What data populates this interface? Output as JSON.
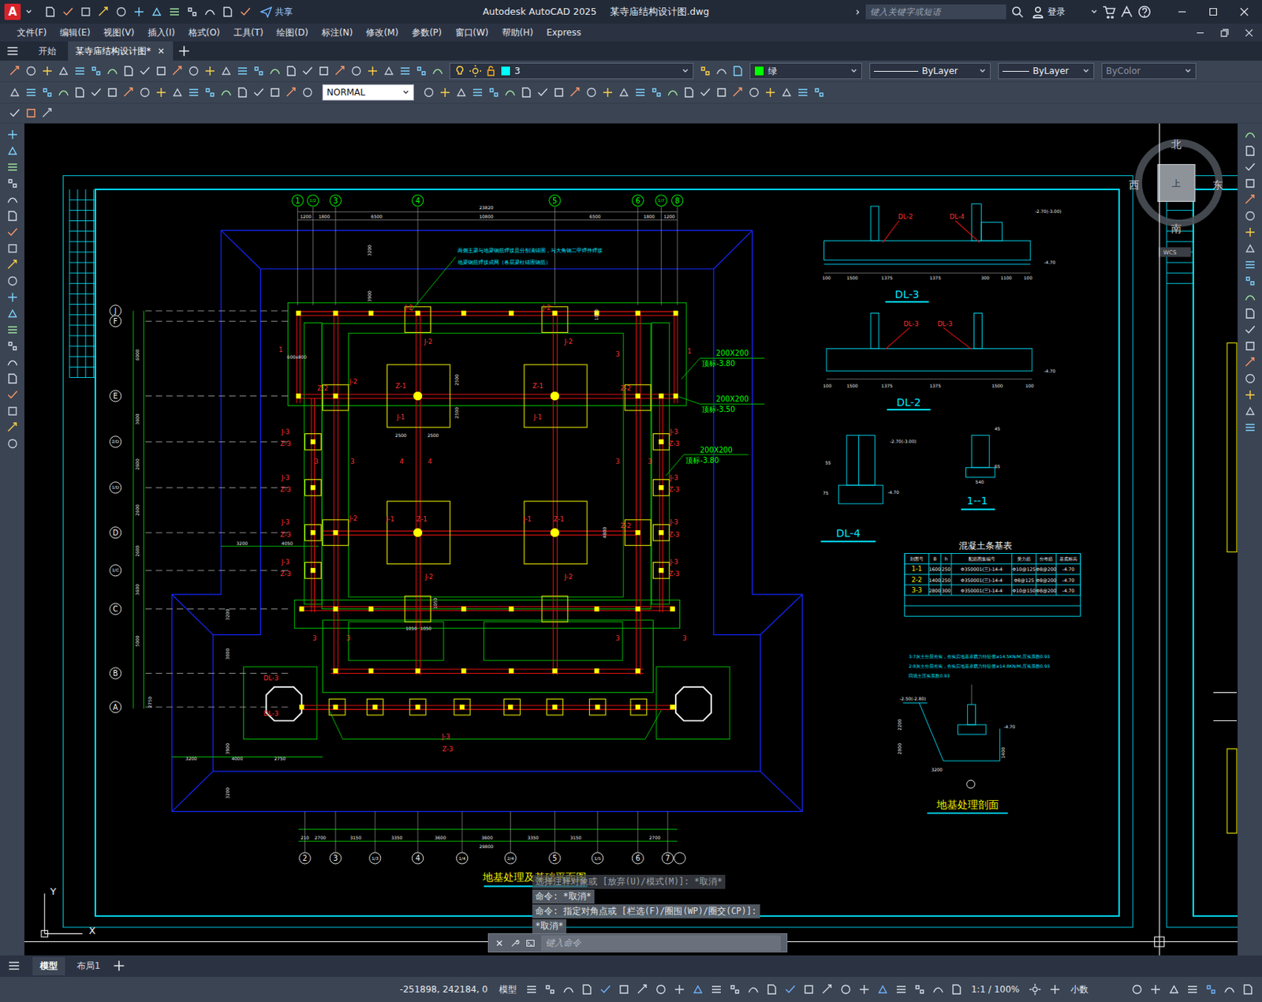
{
  "window": {
    "app_letter": "A",
    "title": "Autodesk AutoCAD 2025",
    "file": "某寺庙结构设计图.dwg",
    "share": "共享",
    "search_placeholder": "键入关键字或短语",
    "login": "登录"
  },
  "menu": [
    "文件(F)",
    "编辑(E)",
    "视图(V)",
    "插入(I)",
    "格式(O)",
    "工具(T)",
    "绘图(D)",
    "标注(N)",
    "修改(M)",
    "参数(P)",
    "窗口(W)",
    "帮助(H)",
    "Express"
  ],
  "doc_tabs": [
    {
      "label": "开始",
      "selected": false
    },
    {
      "label": "某寺庙结构设计图*",
      "selected": true
    }
  ],
  "toolbar": {
    "text_style": "NORMAL",
    "layer": "3",
    "layer_swatch": "#00ffff",
    "color_label": "绿",
    "color_swatch": "#00ff00",
    "linetype": "ByLayer",
    "lineweight": "ByLayer",
    "plotstyle": "ByColor"
  },
  "viewcube": {
    "north": "北",
    "south": "南",
    "east": "东",
    "west": "西",
    "face": "上",
    "ucs": "WCS"
  },
  "ucs_icon": {
    "x": "X",
    "y": "Y"
  },
  "drawing": {
    "plan_title": "地基处理及基础平面图",
    "top_axes": [
      "1",
      "1/2",
      "3",
      "4",
      "5",
      "6",
      "1/7",
      "8"
    ],
    "left_axes": [
      "J",
      "F",
      "E",
      "2/D",
      "1/D",
      "D",
      "1/C",
      "C",
      "B",
      "A"
    ],
    "bottom_axes": [
      "2",
      "3",
      "1/3",
      "4",
      "1/4",
      "2/4",
      "5",
      "1/5",
      "6",
      "7"
    ],
    "top_total": "23820",
    "top_dims": [
      "1200",
      "1800",
      "6500",
      "10800",
      "6500",
      "1800",
      "1200"
    ],
    "bottom_total": "29800",
    "bottom_dims": [
      "210",
      "2700",
      "3150",
      "3350",
      "3600",
      "3600",
      "3350",
      "3150",
      "2700"
    ],
    "left_dims": [
      "6000",
      "3600",
      "2600",
      "2600",
      "2600",
      "3600",
      "5000"
    ],
    "misc_dims": [
      "3200",
      "3900",
      "600x800",
      "2500",
      "2500",
      "2500",
      "2500",
      "1050",
      "1050",
      "1050",
      "3200",
      "4050",
      "3200",
      "3000",
      "2750",
      "3200",
      "4000",
      "2750",
      "3900",
      "3200",
      "1050",
      "4800"
    ],
    "notes": [
      "两侧主梁与地梁钢筋焊接且分别满锚固，与大角钢二甲焊件焊接",
      "地梁钢筋焊接成网（各层梁柱锚固钢筋）"
    ],
    "callouts": [
      {
        "size": "200X200",
        "level": "顶标-3.80"
      },
      {
        "size": "200X200",
        "level": "顶标-3.50"
      },
      {
        "size": "200X200",
        "level": "顶标-3.80"
      }
    ],
    "member_labels": [
      "Z-1",
      "J-1",
      "Z-1",
      "J-1",
      "J-1",
      "Z-1",
      "J-1",
      "Z-1",
      "J-2",
      "J-2",
      "J-2",
      "J-2",
      "J-2",
      "J-2",
      "J-2",
      "J-2",
      "Z-2",
      "Z-2",
      "Z-2",
      "J-3",
      "Z-3",
      "J-3",
      "Z-3",
      "J-3",
      "Z-3",
      "J-3",
      "Z-3",
      "J-3",
      "Z-3",
      "J-3",
      "Z-3",
      "J-3",
      "Z-3",
      "J-3",
      "Z-3",
      "DL-3",
      "DL-3",
      "J-3",
      "Z-3",
      "1",
      "1",
      "3",
      "3",
      "4",
      "4",
      "3",
      "3",
      "3",
      "3",
      "3",
      "3",
      "3"
    ],
    "dl3": {
      "title": "DL-3",
      "tags": [
        "DL-2",
        "DL-4"
      ],
      "dims": [
        "100",
        "1500",
        "1375",
        "1375",
        "300",
        "1100",
        "100"
      ],
      "levels": [
        "-2.70(-3.00)",
        "-4.70"
      ]
    },
    "dl2": {
      "title": "DL-2",
      "tags": [
        "DL-3",
        "DL-3"
      ],
      "dims": [
        "100",
        "1500",
        "1375",
        "1375",
        "1500",
        "100"
      ],
      "levels": [
        "-4.70"
      ]
    },
    "dl4": {
      "title": "DL-4",
      "dims": [
        "55",
        "75"
      ],
      "levels": [
        "-2.70(-3.00)",
        "-4.70"
      ]
    },
    "s11": {
      "title": "1--1",
      "dims": [
        "45",
        "65",
        "540"
      ]
    },
    "table": {
      "title": "混凝土条基表",
      "columns": [
        "剖面号",
        "B",
        "h",
        "配筋图集编号",
        "受力筋",
        "分布筋",
        "基底标高"
      ],
      "rows": [
        [
          "1-1",
          "1600",
          "250",
          "Φ350001(三)-14-4",
          "Φ10@125",
          "Φ8@200",
          "-4.70"
        ],
        [
          "2-2",
          "1400",
          "250",
          "Φ350001(三)-14-4",
          "Φ8@125",
          "Φ8@200",
          "-4.70"
        ],
        [
          "3-3",
          "2800",
          "300",
          "Φ350001(三)-14-4",
          "Φ10@150",
          "Φ8@200",
          "-4.70"
        ]
      ]
    },
    "soil": {
      "title": "地基处理剖面",
      "notes": [
        "3:7灰土分层夯实，夯实后地基承载力特征值≥14.5KN/M,压实系数0.93",
        "2:8灰土分层夯实，夯实后地基承载力特征值≥14.8KN/M,压实系数0.93",
        "回填土压实系数0.93"
      ],
      "levels": [
        "-2.50(-2.80)",
        "-4.70"
      ],
      "dims": [
        "2200",
        "2000",
        "3200",
        "1400"
      ]
    }
  },
  "command_line": {
    "history": [
      "选择注释对象或 [放弃(U)/模式(M)]: *取消*",
      "命令: *取消*",
      "命令: 指定对角点或 [栏选(F)/圈围(WP)/圈交(CP)]:",
      "*取消*"
    ],
    "placeholder": "键入命令"
  },
  "layout_tabs": [
    {
      "label": "模型",
      "selected": true
    },
    {
      "label": "布局1",
      "selected": false
    }
  ],
  "status_bar": {
    "coords": "-251898, 242184, 0",
    "space": "模型",
    "scale": "1:1 / 100%",
    "units": "小数"
  }
}
